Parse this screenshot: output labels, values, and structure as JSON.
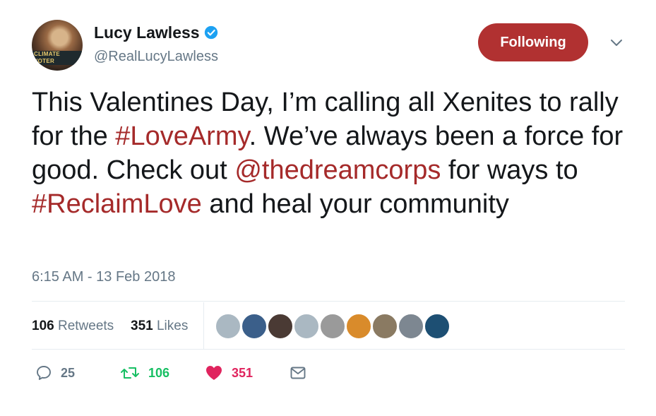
{
  "user": {
    "display_name": "Lucy Lawless",
    "handle": "@RealLucyLawless",
    "avatar_badge": "CLIMATE VOTER",
    "verified": true
  },
  "follow_button": {
    "label": "Following",
    "color": "#b13131"
  },
  "tweet": {
    "segments": [
      {
        "text": "This Valentines Day, I’m calling all Xenites to rally for the ",
        "type": "text"
      },
      {
        "text": "#LoveArmy",
        "type": "hashtag"
      },
      {
        "text": ". We’ve always been a force for good. Check out ",
        "type": "text"
      },
      {
        "text": "@thedreamcorps",
        "type": "mention"
      },
      {
        "text": " for ways to ",
        "type": "text"
      },
      {
        "text": "#ReclaimLove",
        "type": "hashtag"
      },
      {
        "text": " and heal your community",
        "type": "text"
      }
    ],
    "link_color": "#a52a2a",
    "timestamp": "6:15 AM - 13 Feb 2018"
  },
  "stats": {
    "retweets_count": "106",
    "retweets_label": "Retweets",
    "likes_count": "351",
    "likes_label": "Likes"
  },
  "liker_avatars": [
    {
      "name": "default-avatar-1",
      "color": "#aab8c2"
    },
    {
      "name": "greek-flag-avatar",
      "color": "#3b5f8a"
    },
    {
      "name": "dark-avatar",
      "color": "#4a3a34"
    },
    {
      "name": "default-avatar-2",
      "color": "#aab8c2"
    },
    {
      "name": "gray-photo-avatar",
      "color": "#9a9a9a"
    },
    {
      "name": "orange-avatar",
      "color": "#d98b2b"
    },
    {
      "name": "pair-photo-avatar",
      "color": "#8a7a62"
    },
    {
      "name": "landscape-avatar",
      "color": "#7d8791"
    },
    {
      "name": "nough-avatar",
      "color": "#1d4f73"
    }
  ],
  "actions": {
    "reply_count": "25",
    "retweet_count": "106",
    "like_count": "351",
    "retweet_color": "#17bf63",
    "like_color": "#e0245e",
    "icon_color": "#657786"
  }
}
